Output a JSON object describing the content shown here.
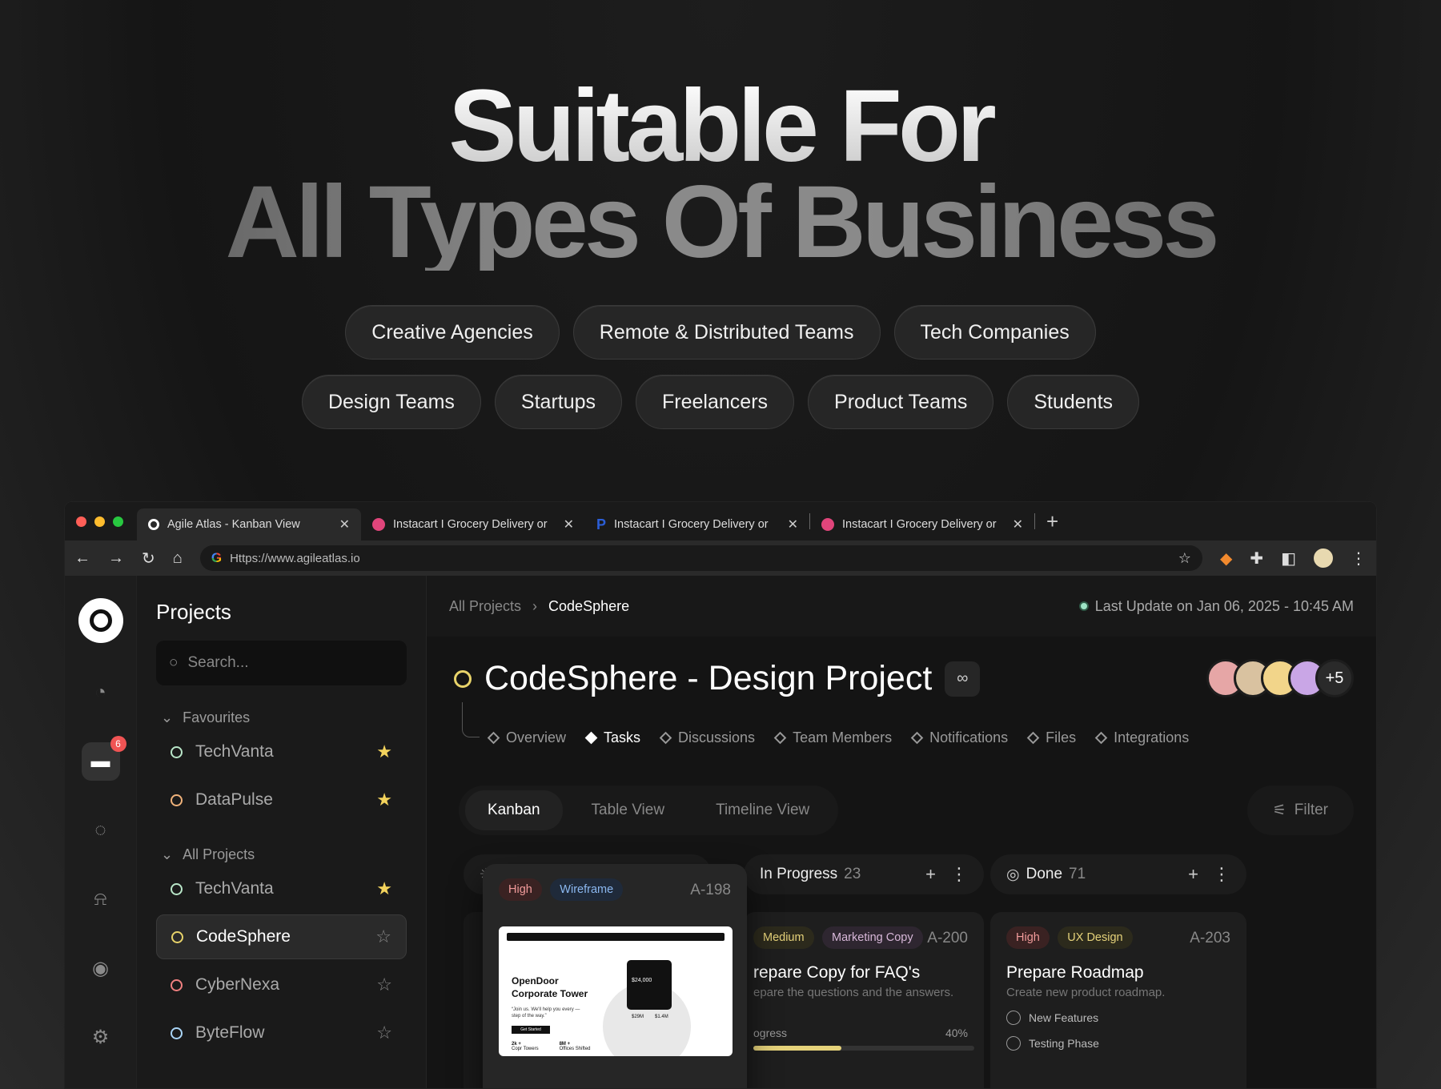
{
  "hero": {
    "line1": "Suitable For",
    "line2": "All Types Of Business"
  },
  "chips_row1": [
    "Creative Agencies",
    "Remote & Distributed Teams",
    "Tech Companies"
  ],
  "chips_row2": [
    "Design Teams",
    "Startups",
    "Freelancers",
    "Product Teams",
    "Students"
  ],
  "browser": {
    "tabs": [
      {
        "label": "Agile Atlas - Kanban View",
        "color": "#ffffff"
      },
      {
        "label": "Instacart I Grocery Delivery or",
        "color": "#e0457b"
      },
      {
        "label": "Instacart I Grocery Delivery or",
        "color": "#2b5ed7"
      },
      {
        "label": "Instacart I Grocery Delivery or",
        "color": "#e0457b"
      }
    ],
    "url": "Https://www.agileatlas.io"
  },
  "rail": {
    "badge": "6"
  },
  "sidebar": {
    "title": "Projects",
    "search_placeholder": "Search...",
    "fav_label": "Favourites",
    "favourites": [
      {
        "name": "TechVanta",
        "color": "#b8e6c8",
        "starred": true
      },
      {
        "name": "DataPulse",
        "color": "#f0b27a",
        "starred": true
      }
    ],
    "all_label": "All Projects",
    "projects": [
      {
        "name": "TechVanta",
        "color": "#b8e6c8",
        "starred": true
      },
      {
        "name": "CodeSphere",
        "color": "#e8d36a",
        "starred": false
      },
      {
        "name": "CyberNexa",
        "color": "#f08080",
        "starred": false
      },
      {
        "name": "ByteFlow",
        "color": "#a9d4f5",
        "starred": false
      }
    ]
  },
  "main": {
    "crumb_root": "All Projects",
    "crumb_current": "CodeSphere",
    "last_update": "Last Update on Jan 06, 2025 - 10:45 AM",
    "title": "CodeSphere - Design Project",
    "avatars_more": "+5",
    "subtabs": [
      "Overview",
      "Tasks",
      "Discussions",
      "Team Members",
      "Notifications",
      "Files",
      "Integrations"
    ],
    "views": [
      "Kanban",
      "Table View",
      "Timeline View"
    ],
    "filter": "Filter"
  },
  "columns": [
    {
      "title": "In Progress",
      "count": "23"
    },
    {
      "title": "Done",
      "count": "71"
    }
  ],
  "float_card": {
    "priority": "High",
    "tag": "Wireframe",
    "id": "A-198",
    "mock": {
      "head": "OpenDoor",
      "sub": "Corporate Tower",
      "quote": "“Join us. We'll help you every — step of the way.”",
      "price": "$24,000",
      "stat1": "$29M",
      "stat2": "$1.4M",
      "cta": "Get Started",
      "stat3": "2k +",
      "stat4": "8M +",
      "stat3_label": "Copr Towers",
      "stat4_label": "Offices Shifted"
    }
  },
  "card_progress": {
    "priority": "Medium",
    "tag": "Marketing Copy",
    "id": "A-200",
    "title": "repare Copy for FAQ's",
    "desc": "epare the questions and the answers.",
    "progress_label": "ogress",
    "progress_text": "40%",
    "progress": 0.4
  },
  "card_done": {
    "priority": "High",
    "tag": "UX Design",
    "id": "A-203",
    "title": "Prepare Roadmap",
    "desc": "Create new product roadmap.",
    "checks": [
      "New Features",
      "Testing Phase"
    ]
  }
}
